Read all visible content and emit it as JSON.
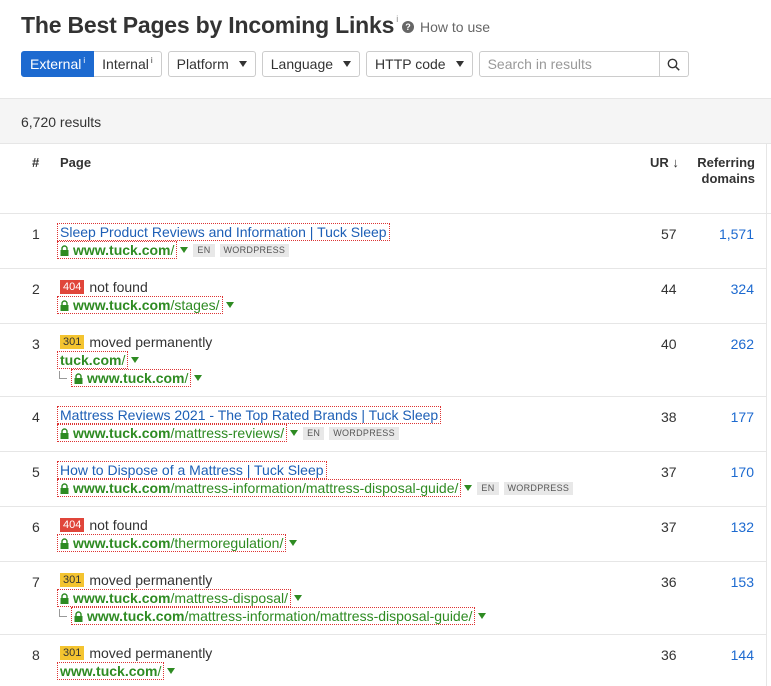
{
  "header": {
    "title": "The Best Pages by Incoming Links",
    "title_info": "i",
    "how_to_use": "How to use"
  },
  "toolbar": {
    "external_label": "External",
    "internal_label": "Internal",
    "info_mark": "i",
    "platform_label": "Platform",
    "language_label": "Language",
    "http_code_label": "HTTP code",
    "search_placeholder": "Search in results"
  },
  "results_count": "6,720 results",
  "table": {
    "headers": {
      "num": "#",
      "page": "Page",
      "ur": "UR",
      "ur_sort": "↓",
      "ref1": "Referring",
      "ref2": "domains"
    },
    "rows": [
      {
        "num": "1",
        "ur": "57",
        "ref": "1,571",
        "title": "Sleep Product Reviews and Information | Tuck Sleep",
        "domain": "www.tuck.com",
        "path": "/",
        "tags": [
          "EN",
          "WORDPRESS"
        ]
      },
      {
        "num": "2",
        "ur": "44",
        "ref": "324",
        "badge": "404",
        "status": "not found",
        "domain": "www.tuck.com",
        "path": "/stages/"
      },
      {
        "num": "3",
        "ur": "40",
        "ref": "262",
        "badge": "301",
        "status": "moved permanently",
        "domain": "tuck.com",
        "path": "/",
        "redirect_domain": "www.tuck.com",
        "redirect_path": "/"
      },
      {
        "num": "4",
        "ur": "38",
        "ref": "177",
        "title": "Mattress Reviews 2021 - The Top Rated Brands | Tuck Sleep",
        "domain": "www.tuck.com",
        "path": "/mattress-reviews/",
        "tags": [
          "EN",
          "WORDPRESS"
        ]
      },
      {
        "num": "5",
        "ur": "37",
        "ref": "170",
        "title": "How to Dispose of a Mattress | Tuck Sleep",
        "domain": "www.tuck.com",
        "path": "/mattress-information/mattress-disposal-guide/",
        "tags": [
          "EN",
          "WORDPRESS"
        ]
      },
      {
        "num": "6",
        "ur": "37",
        "ref": "132",
        "badge": "404",
        "status": "not found",
        "domain": "www.tuck.com",
        "path": "/thermoregulation/"
      },
      {
        "num": "7",
        "ur": "36",
        "ref": "153",
        "badge": "301",
        "status": "moved permanently",
        "domain": "www.tuck.com",
        "path": "/mattress-disposal/",
        "redirect_domain": "www.tuck.com",
        "redirect_path": "/mattress-information/mattress-disposal-guide/"
      },
      {
        "num": "8",
        "ur": "36",
        "ref": "144",
        "badge": "301",
        "status": "moved permanently",
        "domain": "www.tuck.com",
        "path": "/"
      }
    ]
  },
  "colors": {
    "accent": "#1d6ad0",
    "link": "#1d5fb6",
    "url_green": "#2e8b22",
    "badge_404": "#e0453a",
    "badge_301": "#f4c430"
  }
}
